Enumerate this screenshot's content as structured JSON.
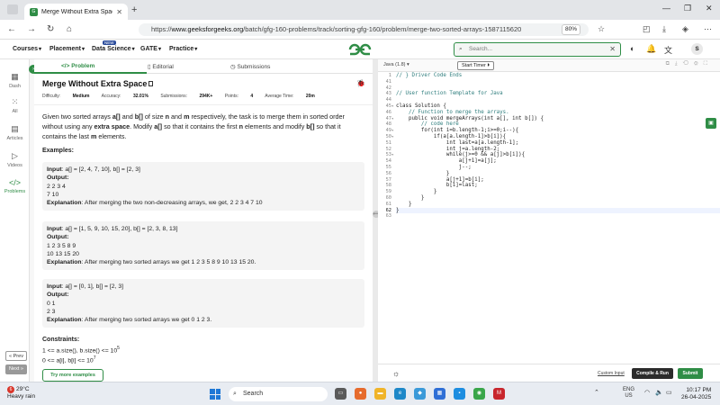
{
  "browser": {
    "tab_title": "Merge Without Extra Space | P",
    "url_prefix": "https://",
    "url_host": "www.geeksforgeeks.org",
    "url_path": "/batch/gfg-160-problems/track/sorting-gfg-160/problem/merge-two-sorted-arrays-1587115620",
    "zoom": "80%"
  },
  "header": {
    "menus": [
      "Courses",
      "Placement",
      "Data Science",
      "GATE",
      "Practice"
    ],
    "new_badge": "NEW",
    "search_placeholder": "Search...",
    "avatar_letter": "S"
  },
  "rail": {
    "items": [
      "Dash",
      "All",
      "Articles",
      "Videos",
      "Problems"
    ],
    "prev": "« Prev",
    "next": "Next »"
  },
  "problem": {
    "tabs": [
      "Problem",
      "Editorial",
      "Submissions"
    ],
    "title": "Merge Without Extra Space",
    "difficulty_label": "Difficulty:",
    "difficulty": "Medium",
    "accuracy_label": "Accuracy:",
    "accuracy": "32.01%",
    "submissions_label": "Submissions:",
    "submissions": "294K+",
    "points_label": "Points:",
    "points": "4",
    "avg_time_label": "Average Time:",
    "avg_time": "20m",
    "desc_p1": "Given two sorted arrays ",
    "desc_a": "a[]",
    "desc_p2": " and ",
    "desc_b": "b[]",
    "desc_p3": " of size ",
    "desc_n": "n",
    "desc_p4": " and ",
    "desc_m": "m",
    "desc_p5": " respectively, the task is to merge them in sorted order without using any ",
    "desc_extra": "extra space",
    "desc_p6": ". Modify ",
    "desc_p7": " so that it contains the first ",
    "desc_p8": " elements and modify ",
    "desc_p9": " so that it contains the last ",
    "desc_p10": " elements.",
    "examples_heading": "Examples:",
    "examples": [
      {
        "input_label": "Input",
        "input": ": a[] = [2, 4, 7, 10], b[] = [2, 3]",
        "output_label": "Output",
        "output_lines": [
          "2 2 3 4",
          "7 10"
        ],
        "expl_label": "Explanation",
        "explanation": ": After merging the two non-decreasing arrays, we get, 2 2 3 4 7 10"
      },
      {
        "input_label": "Input",
        "input": ": a[] = [1, 5, 9, 10, 15, 20], b[] = [2, 3, 8, 13]",
        "output_label": "Output",
        "output_lines": [
          "1 2 3 5 8 9",
          "10 13 15 20"
        ],
        "expl_label": "Explanation",
        "explanation": ": After merging two sorted arrays we get 1 2 3 5 8 9 10 13 15 20."
      },
      {
        "input_label": "Input",
        "input": ": a[] = [0, 1], b[] = [2, 3]",
        "output_label": "Output",
        "output_lines": [
          "0 1",
          "2 3"
        ],
        "expl_label": "Explanation",
        "explanation": ": After merging two sorted arrays we get 0 1 2 3."
      }
    ],
    "constraints_heading": "Constraints:",
    "constraint1": "1 <= a.size(), b.size() <= 10",
    "constraint1_exp": "5",
    "constraint2": "0 <= a[i], b[i] <= 10",
    "constraint2_exp": "7",
    "try_more": "Try more examples"
  },
  "editor": {
    "language": "Java (1.8)",
    "timer": "Start Timer",
    "lines": [
      {
        "n": "1",
        "t": "// } Driver Code Ends",
        "cls": "cm"
      },
      {
        "n": "41",
        "t": ""
      },
      {
        "n": "42",
        "t": ""
      },
      {
        "n": "43",
        "t": "// User function Template for Java",
        "cls": "cm"
      },
      {
        "n": "44",
        "t": ""
      },
      {
        "n": "45",
        "t": "class Solution {",
        "fold": true
      },
      {
        "n": "46",
        "t": "    // Function to merge the arrays.",
        "cls": "cm"
      },
      {
        "n": "47",
        "t": "    public void mergeArrays(int a[], int b[]) {",
        "fold": true
      },
      {
        "n": "48",
        "t": "        // code here",
        "cls": "cm"
      },
      {
        "n": "49",
        "t": "        for(int i=b.length-1;i>=0;i--){",
        "fold": true
      },
      {
        "n": "50",
        "t": "            if(a[a.length-1]>b[i]){",
        "fold": true
      },
      {
        "n": "51",
        "t": "                int last=a[a.length-1];"
      },
      {
        "n": "52",
        "t": "                int j=a.length-2;"
      },
      {
        "n": "53",
        "t": "                while(j>=0 && a[j]>b[i]){",
        "fold": true
      },
      {
        "n": "54",
        "t": "                    a[j+1]=a[j];"
      },
      {
        "n": "55",
        "t": "                    j--;"
      },
      {
        "n": "56",
        "t": "                }"
      },
      {
        "n": "57",
        "t": "                a[j+1]=b[i];"
      },
      {
        "n": "58",
        "t": "                b[i]=last;"
      },
      {
        "n": "59",
        "t": "            }"
      },
      {
        "n": "60",
        "t": "        }"
      },
      {
        "n": "61",
        "t": "    }"
      },
      {
        "n": "62",
        "t": "}",
        "cur": true
      },
      {
        "n": "63",
        "t": ""
      }
    ],
    "custom_input": "Custom Input",
    "compile": "Compile & Run",
    "submit": "Submit"
  },
  "taskbar": {
    "temp": "29°C",
    "weather": "Heavy rain",
    "search": "Search",
    "lang1": "ENG",
    "lang2": "US",
    "time": "10:17 PM",
    "date": "26-04-2025"
  }
}
